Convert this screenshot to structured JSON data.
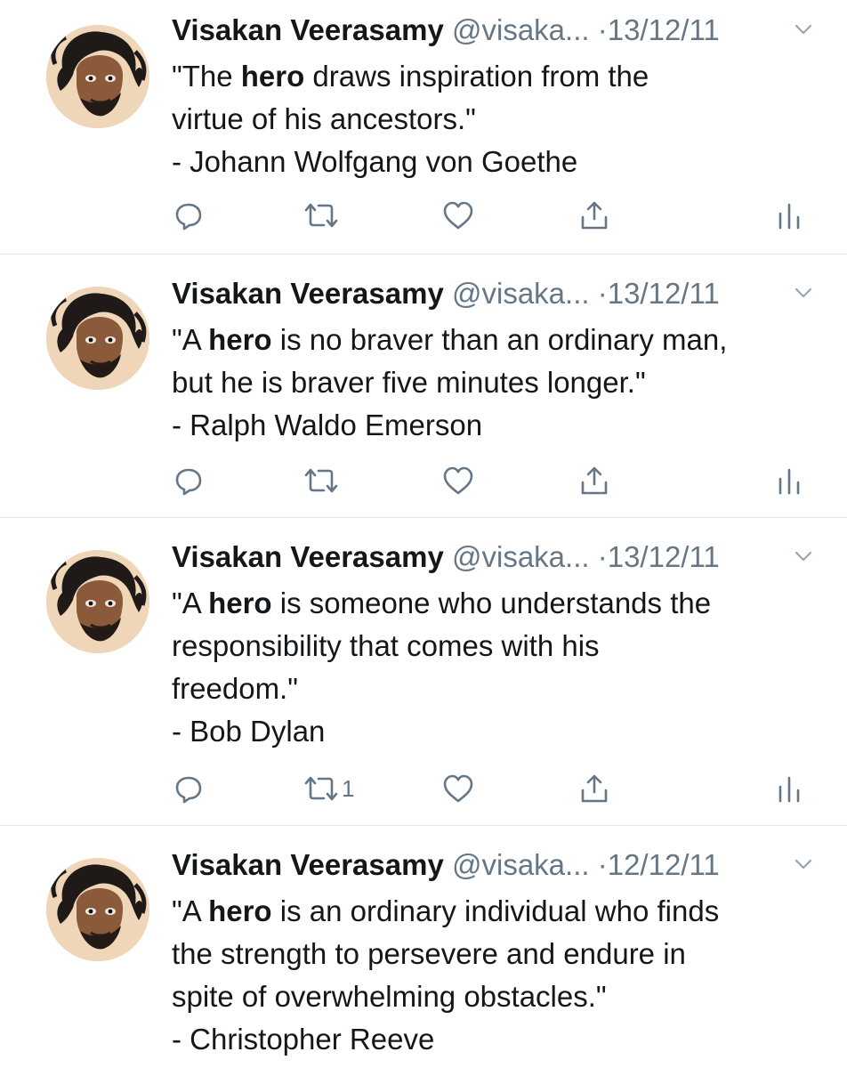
{
  "colors": {
    "primary_text": "#14171a",
    "secondary_text": "#657786",
    "divider": "#e1e8ed",
    "icon": "#657786"
  },
  "icons": {
    "reply": "reply-icon",
    "retweet": "retweet-icon",
    "like": "heart-icon",
    "share": "share-icon",
    "analytics": "analytics-icon",
    "menu": "chevron-down-icon"
  },
  "tweets": [
    {
      "name": "Visakan Veerasamy",
      "handle": "@visaka...",
      "separator": "·",
      "date": "13/12/11",
      "text_before": "\"The ",
      "text_bold": "hero",
      "text_after": " draws inspiration from the\nvirtue of his ancestors.\"\n- Johann Wolfgang von Goethe",
      "retweet_count": ""
    },
    {
      "name": "Visakan Veerasamy",
      "handle": "@visaka...",
      "separator": "·",
      "date": "13/12/11",
      "text_before": "\"A ",
      "text_bold": "hero",
      "text_after": " is no braver than an ordinary man,\nbut he is braver five minutes longer.\"\n- Ralph Waldo Emerson",
      "retweet_count": ""
    },
    {
      "name": "Visakan Veerasamy",
      "handle": "@visaka...",
      "separator": "·",
      "date": "13/12/11",
      "text_before": "\"A ",
      "text_bold": "hero",
      "text_after": " is someone who understands the\nresponsibility that comes with his\nfreedom.\"\n- Bob Dylan",
      "retweet_count": "1"
    },
    {
      "name": "Visakan Veerasamy",
      "handle": "@visaka...",
      "separator": "·",
      "date": "12/12/11",
      "text_before": "\"A ",
      "text_bold": "hero",
      "text_after": " is an ordinary individual who finds\nthe strength to persevere and endure in\nspite of overwhelming obstacles.\"\n- Christopher Reeve",
      "retweet_count": ""
    }
  ]
}
